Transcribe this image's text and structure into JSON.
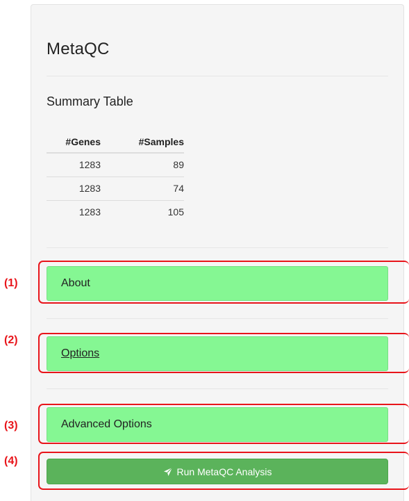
{
  "app": {
    "title": "MetaQC"
  },
  "summary": {
    "title": "Summary Table",
    "columns": [
      "#Genes",
      "#Samples"
    ],
    "rows": [
      [
        "1283",
        "89"
      ],
      [
        "1283",
        "74"
      ],
      [
        "1283",
        "105"
      ]
    ]
  },
  "sections": {
    "about": "About",
    "options": "Options",
    "advanced": "Advanced Options"
  },
  "run_button": {
    "label": "Run MetaQC Analysis",
    "icon": "rocket-icon"
  },
  "annotations": [
    "(1)",
    "(2)",
    "(3)",
    "(4)"
  ],
  "colors": {
    "panel_bg": "#f5f5f5",
    "section_green": "#85f793",
    "run_green": "#5bb35b",
    "annotation_red": "#e8141a"
  }
}
